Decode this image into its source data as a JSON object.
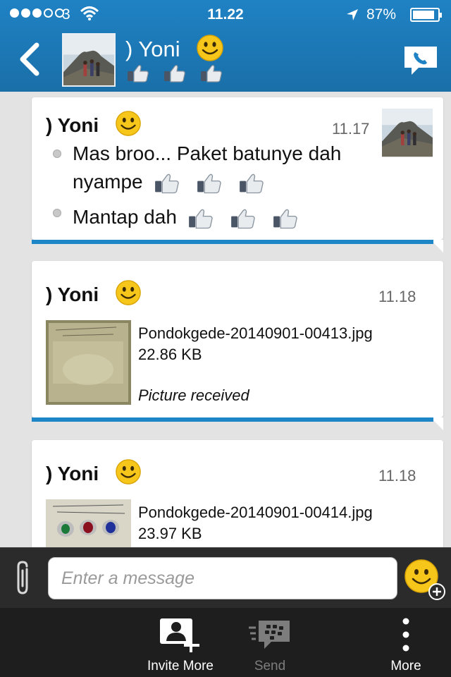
{
  "status_bar": {
    "carrier": "3",
    "time": "11.22",
    "battery": "87%",
    "battery_level": 0.87,
    "signal_filled": 3,
    "signal_total": 5
  },
  "header": {
    "contact_name": ") Yoni",
    "icons": [
      "back-chevron-icon",
      "contact-avatar",
      "smiley-icon",
      "thumbs-up-icon",
      "phone-call-icon"
    ]
  },
  "messages": [
    {
      "sender": ") Yoni",
      "time": "11.17",
      "lines": [
        "Mas broo... Paket batunye dah",
        "nyampe",
        "Mantap dah"
      ]
    },
    {
      "sender": ") Yoni",
      "time": "11.18",
      "file_name": "Pondokgede-20140901-00413.jpg",
      "file_size": "22.86 KB",
      "status": "Picture received"
    },
    {
      "sender": ") Yoni",
      "time": "11.18",
      "file_name": "Pondokgede-20140901-00414.jpg",
      "file_size": "23.97 KB"
    }
  ],
  "composer": {
    "placeholder": "Enter a message"
  },
  "toolbar": {
    "invite_label": "Invite More",
    "send_label": "Send",
    "more_label": "More"
  },
  "colors": {
    "header_blue": "#1f82c4",
    "bubble_accent": "#1c86c7",
    "toolbar_bg": "#1e1e1e"
  }
}
